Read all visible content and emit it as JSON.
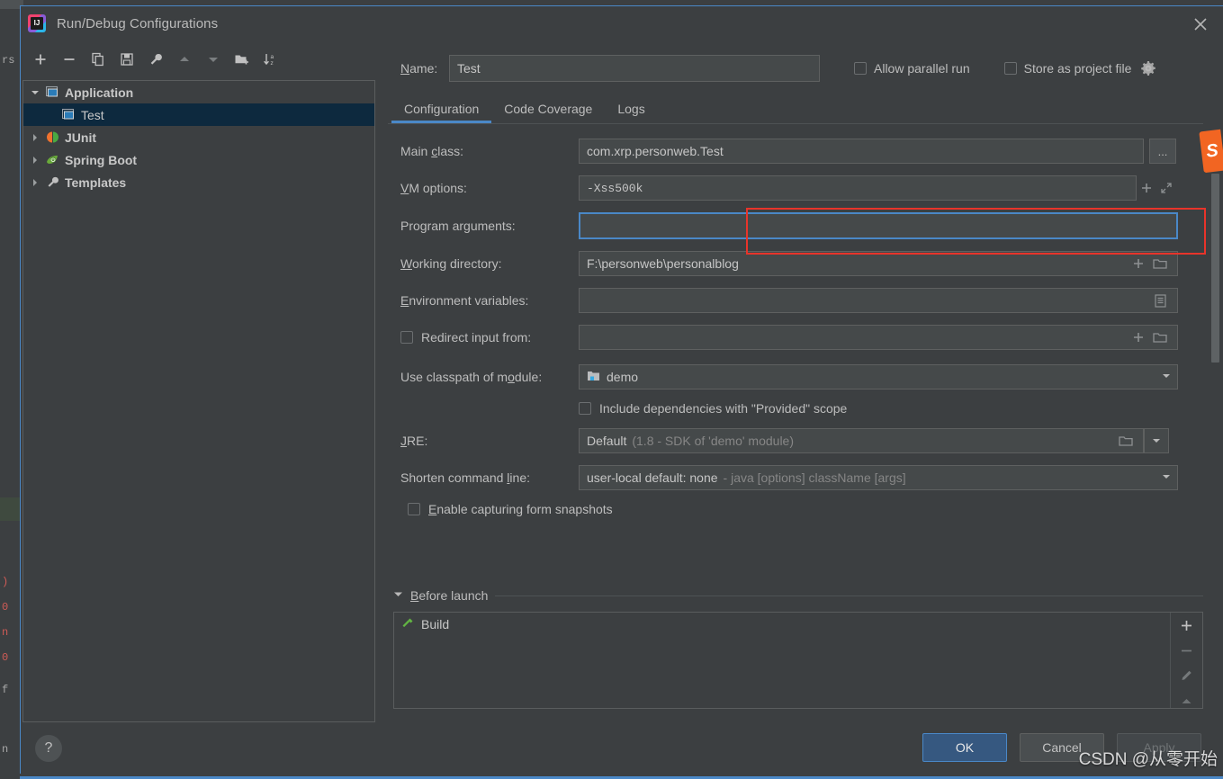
{
  "window": {
    "title": "Run/Debug Configurations",
    "app_icon": "intellij-idea-icon",
    "close_icon": "close-icon"
  },
  "sidebar": {
    "toolbar": [
      {
        "name": "add-configuration-button",
        "icon": "plus-icon"
      },
      {
        "name": "remove-configuration-button",
        "icon": "minus-icon"
      },
      {
        "name": "copy-configuration-button",
        "icon": "copy-icon"
      },
      {
        "name": "save-configuration-button",
        "icon": "save-icon"
      },
      {
        "name": "edit-templates-button",
        "icon": "wrench-icon"
      },
      {
        "name": "move-up-button",
        "icon": "arrow-up-icon"
      },
      {
        "name": "move-down-button",
        "icon": "arrow-down-icon"
      },
      {
        "name": "new-folder-button",
        "icon": "folder-plus-icon"
      },
      {
        "name": "sort-configurations-button",
        "icon": "sort-az-icon"
      }
    ],
    "tree": [
      {
        "label": "Application",
        "icon": "application-icon",
        "level": 0,
        "expanded": true,
        "selected": false,
        "has_twisty": true
      },
      {
        "label": "Test",
        "icon": "application-icon",
        "level": 1,
        "expanded": false,
        "selected": true,
        "has_twisty": false
      },
      {
        "label": "JUnit",
        "icon": "junit-icon",
        "level": 0,
        "expanded": false,
        "selected": false,
        "has_twisty": true
      },
      {
        "label": "Spring Boot",
        "icon": "spring-boot-icon",
        "level": 0,
        "expanded": false,
        "selected": false,
        "has_twisty": true
      },
      {
        "label": "Templates",
        "icon": "wrench-icon",
        "level": 0,
        "expanded": false,
        "selected": false,
        "has_twisty": true
      }
    ],
    "help_label": "?"
  },
  "header": {
    "name_label": "Name:",
    "name_value": "Test",
    "allow_parallel_run_label": "Allow parallel run",
    "allow_parallel_run_checked": false,
    "store_as_project_file_label": "Store as project file",
    "store_as_project_file_checked": false,
    "gear_icon": "gear-icon"
  },
  "tabs": [
    {
      "label": "Configuration",
      "active": true
    },
    {
      "label": "Code Coverage",
      "active": false
    },
    {
      "label": "Logs",
      "active": false
    }
  ],
  "form": {
    "main_class": {
      "label": "Main class:",
      "value": "com.xrp.personweb.Test",
      "browse_label": "..."
    },
    "vm_options": {
      "label": "VM options:",
      "value": "-Xss500k",
      "highlighted": true
    },
    "program_arguments": {
      "label": "Program arguments:",
      "value": "",
      "focused": true
    },
    "working_directory": {
      "label": "Working directory:",
      "value": "F:\\personweb\\personalblog"
    },
    "environment_variables": {
      "label": "Environment variables:",
      "value": ""
    },
    "redirect_input": {
      "label": "Redirect input from:",
      "checked": false,
      "value": ""
    },
    "classpath_module": {
      "label": "Use classpath of module:",
      "value": "demo"
    },
    "include_provided": {
      "label": "Include dependencies with \"Provided\" scope",
      "checked": false
    },
    "jre": {
      "label": "JRE:",
      "value": "Default",
      "value_suffix": "(1.8 - SDK of 'demo' module)"
    },
    "shorten_command_line": {
      "label": "Shorten command line:",
      "value": "user-local default: none",
      "value_suffix": "- java [options] className [args]"
    },
    "form_snapshots": {
      "label": "Enable capturing form snapshots",
      "checked": false
    }
  },
  "before_launch": {
    "title": "Before launch",
    "expanded": true,
    "items": [
      {
        "label": "Build",
        "icon": "build-hammer-icon"
      }
    ],
    "side_buttons": [
      {
        "name": "add-task-button",
        "icon": "plus-icon"
      },
      {
        "name": "remove-task-button",
        "icon": "minus-icon"
      },
      {
        "name": "edit-task-button",
        "icon": "pencil-icon"
      },
      {
        "name": "move-task-up-button",
        "icon": "arrow-up-icon"
      }
    ]
  },
  "footer": {
    "ok_label": "OK",
    "cancel_label": "Cancel",
    "apply_label": "Apply",
    "apply_disabled": true
  },
  "watermark": "CSDN @从零开始",
  "colors": {
    "dialog_bg": "#3c3f41",
    "field_bg": "#45494a",
    "accent_blue": "#4a88c7",
    "selection_blue": "#0d293e",
    "ok_button": "#365880",
    "annotation_red": "#e8342a"
  }
}
